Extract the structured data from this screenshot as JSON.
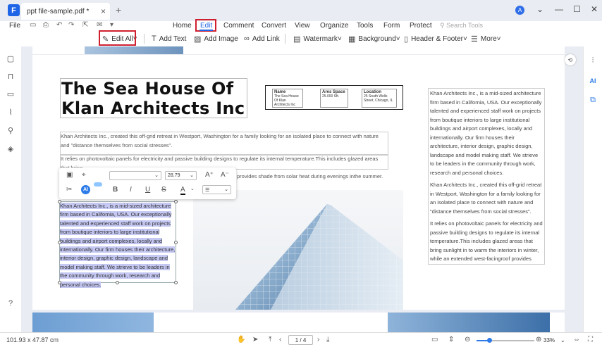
{
  "titlebar": {
    "tab_title": "ppt file-sample.pdf *",
    "tab_close": "×",
    "new_tab": "+",
    "app_logo": "F",
    "avatar_initial": "A",
    "window_controls": [
      "⌄",
      "—",
      "☐",
      "✕"
    ]
  },
  "menu": {
    "file": "File",
    "items": [
      "Home",
      "Edit",
      "Comment",
      "Convert",
      "View",
      "Organize",
      "Tools",
      "Form",
      "Protect"
    ],
    "active": "Edit",
    "search_placeholder": "Search Tools"
  },
  "toolbar": {
    "edit_all": "Edit All",
    "add_text": "Add Text",
    "add_image": "Add Image",
    "add_link": "Add Link",
    "watermark": "Watermark",
    "background": "Background",
    "header_footer": "Header & Footer",
    "more": "More"
  },
  "document": {
    "title": "The Sea House Of Klan Architects Inc",
    "table": {
      "name_label": "Name",
      "name_value": "The Sea House Of Klan Architects Inc",
      "area_label": "Ares Space",
      "area_value": "25.000 Sft.",
      "location_label": "Location",
      "location_value": "25 South Wells Street, Chicago, IL"
    },
    "para1": "Khan Architects Inc., created this off-grid retreat in Westport, Washington for a family looking for an isolated place to connect with nature and \"distance themselves from social stresses\".",
    "para2a": "It relies on photovoltaic panels for electricity and passive building designs to regulate its internal temperature.This includes glazed areas that bring",
    "para2b": "provides shade from solar heat during evenings inthe summer.",
    "selected_para": "Khan Architects Inc., is a mid-sized architecture firm based in California, USA. Our exceptionally talented and experienced staff work on projects from boutique interiors to large institutional buildings and airport complexes, locally and internationally. Our firm houses their architecture, interior design, graphic design, landscape and model making staff. We strieve to be leaders in the community through work, research and personal choices.",
    "right_p1": "Khan Architects Inc., is a mid-sized architecture firm based in California, USA. Our exceptionally talented and experienced staff work on projects from boutique interiors to large institutional buildings and airport complexes, locally and internationally. Our firm houses their architecture, interior design, graphic design, landscape and model making staff. We strieve to be leaders in the community through work, research and personal choices.",
    "right_p2": "Khan Architects Inc., created this off-grid retreat in Westport, Washington for a family looking for an isolated place to connect with nature and \"distance themselves from social stresses\".",
    "right_p3": "It relies on photovoltaic panels for electricity and passive building designs to regulate its internal temperature.This includes glazed areas that bring sunlight in to warm the interiors in winter, while an extended west-facingroof provides shade from solar heat during evenings inthe summer."
  },
  "format_popup": {
    "font_size": "28.79",
    "ai_label": "AI"
  },
  "status": {
    "dimensions": "101.93 x 47.87 cm",
    "page_indicator": "1 / 4",
    "zoom": "33%",
    "zoom_fraction": 0.22
  },
  "colors": {
    "accent": "#1e64e6",
    "highlight_box": "#d02030",
    "selection": "#c5c8f3"
  }
}
